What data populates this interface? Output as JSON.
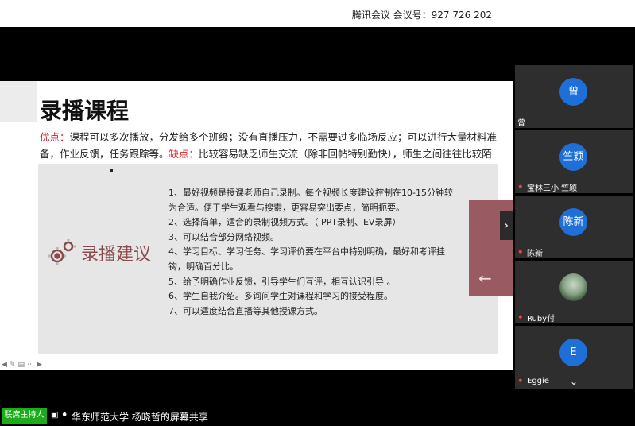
{
  "meeting": {
    "info": "腾讯会议 会议号：927 726 202"
  },
  "slide": {
    "title": "录播课程",
    "pros_label": "优点：",
    "pros_text": "课程可以多次播放，分发给多个班级；没有直播压力，不需要过多临场反应；可以进行大量材料准备，作业反馈，任务跟踪等。",
    "cons_label": "缺点：",
    "cons_text": "比较容易缺乏师生交流（除非回帖特别勤快），师生之间往往比较陌生。",
    "panel_label": "录播建议",
    "tips": [
      "1、最好视频是授课老师自己录制。每个视频长度建议控制在10-15分钟较为合适。便于学生观看与搜索，更容易突出要点，简明扼要。",
      "2、选择简单，适合的录制视频方式。（ PPT录制、EV录屏）",
      "3、可以结合部分网络视频。",
      "4、学习目标、学习任务、学习评价要在平台中特别明确，最好和考评挂钩，明确百分比。",
      "5、给予明确作业反馈，引导学生们互评，相互认识引导 。",
      "6、学生自我介绍。多询问学生对课程和学习的接受程度。",
      "7、可以适度结合直播等其他授课方式。"
    ]
  },
  "participants": [
    {
      "avatar": "曾",
      "name": "曾",
      "mic": false,
      "photo": false
    },
    {
      "avatar": "竺颖",
      "name": "宝林三小 竺颖",
      "mic": true,
      "photo": false
    },
    {
      "avatar": "陈新",
      "name": "陈新",
      "mic": true,
      "photo": false
    },
    {
      "avatar": "",
      "name": "Ruby付",
      "mic": true,
      "photo": true
    },
    {
      "avatar": "E",
      "name": "Eggie",
      "mic": true,
      "photo": false
    }
  ],
  "bottom": {
    "host_button": "联席主持人",
    "share_text": "华东师范大学 杨晓哲的屏幕共享"
  },
  "colors": {
    "accent_red": "#d3262a",
    "host_green": "#1aad19",
    "avatar_blue": "#1f6fd8",
    "slide_rose": "#9a5a61"
  }
}
